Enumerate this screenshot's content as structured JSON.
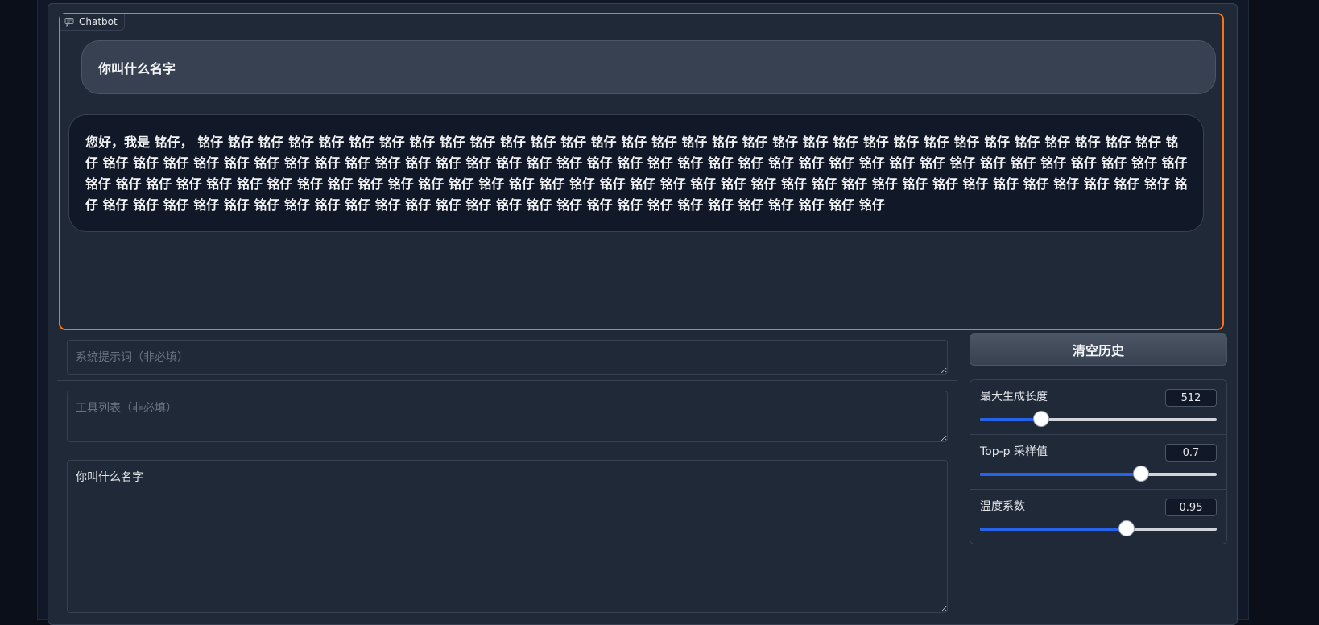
{
  "chatbot": {
    "label": "Chatbot",
    "messages": {
      "user": "你叫什么名字",
      "bot": "您好，我是 铭仔， 铭仔 铭仔 铭仔 铭仔 铭仔 铭仔 铭仔 铭仔 铭仔 铭仔 铭仔 铭仔 铭仔 铭仔 铭仔 铭仔 铭仔 铭仔 铭仔 铭仔 铭仔 铭仔 铭仔 铭仔 铭仔 铭仔 铭仔 铭仔 铭仔 铭仔 铭仔 铭仔 铭仔 铭仔 铭仔 铭仔 铭仔 铭仔 铭仔 铭仔 铭仔 铭仔 铭仔 铭仔 铭仔 铭仔 铭仔 铭仔 铭仔 铭仔 铭仔 铭仔 铭仔 铭仔 铭仔 铭仔 铭仔 铭仔 铭仔 铭仔 铭仔 铭仔 铭仔 铭仔 铭仔 铭仔 铭仔 铭仔 铭仔 铭仔 铭仔 铭仔 铭仔 铭仔 铭仔 铭仔 铭仔 铭仔 铭仔 铭仔 铭仔 铭仔 铭仔 铭仔 铭仔 铭仔 铭仔 铭仔 铭仔 铭仔 铭仔 铭仔 铭仔 铭仔 铭仔 铭仔 铭仔 铭仔 铭仔 铭仔 铭仔 铭仔 铭仔 铭仔 铭仔 铭仔 铭仔 铭仔 铭仔 铭仔 铭仔 铭仔 铭仔 铭仔 铭仔 铭仔 铭仔 铭仔 铭仔 铭仔 铭仔 铭仔 铭仔 铭仔 铭仔 铭仔 铭仔 铭仔 铭仔 铭仔 铭仔 铭仔"
    }
  },
  "inputs": {
    "system_prompt": {
      "value": "",
      "placeholder": "系统提示词（非必填）"
    },
    "tools": {
      "value": "",
      "placeholder": "工具列表（非必填）"
    },
    "query": {
      "value": "你叫什么名字",
      "placeholder": ""
    }
  },
  "buttons": {
    "clear_history": "清空历史"
  },
  "params": [
    {
      "label": "最大生成长度",
      "value": "512",
      "fraction": 0.26
    },
    {
      "label": "Top-p 采样值",
      "value": "0.7",
      "fraction": 0.68
    },
    {
      "label": "温度系数",
      "value": "0.95",
      "fraction": 0.62
    }
  ],
  "colors": {
    "accent": "#f97316",
    "slider": "#2563eb",
    "background": "#0b0f19",
    "panel": "#1f2937"
  }
}
